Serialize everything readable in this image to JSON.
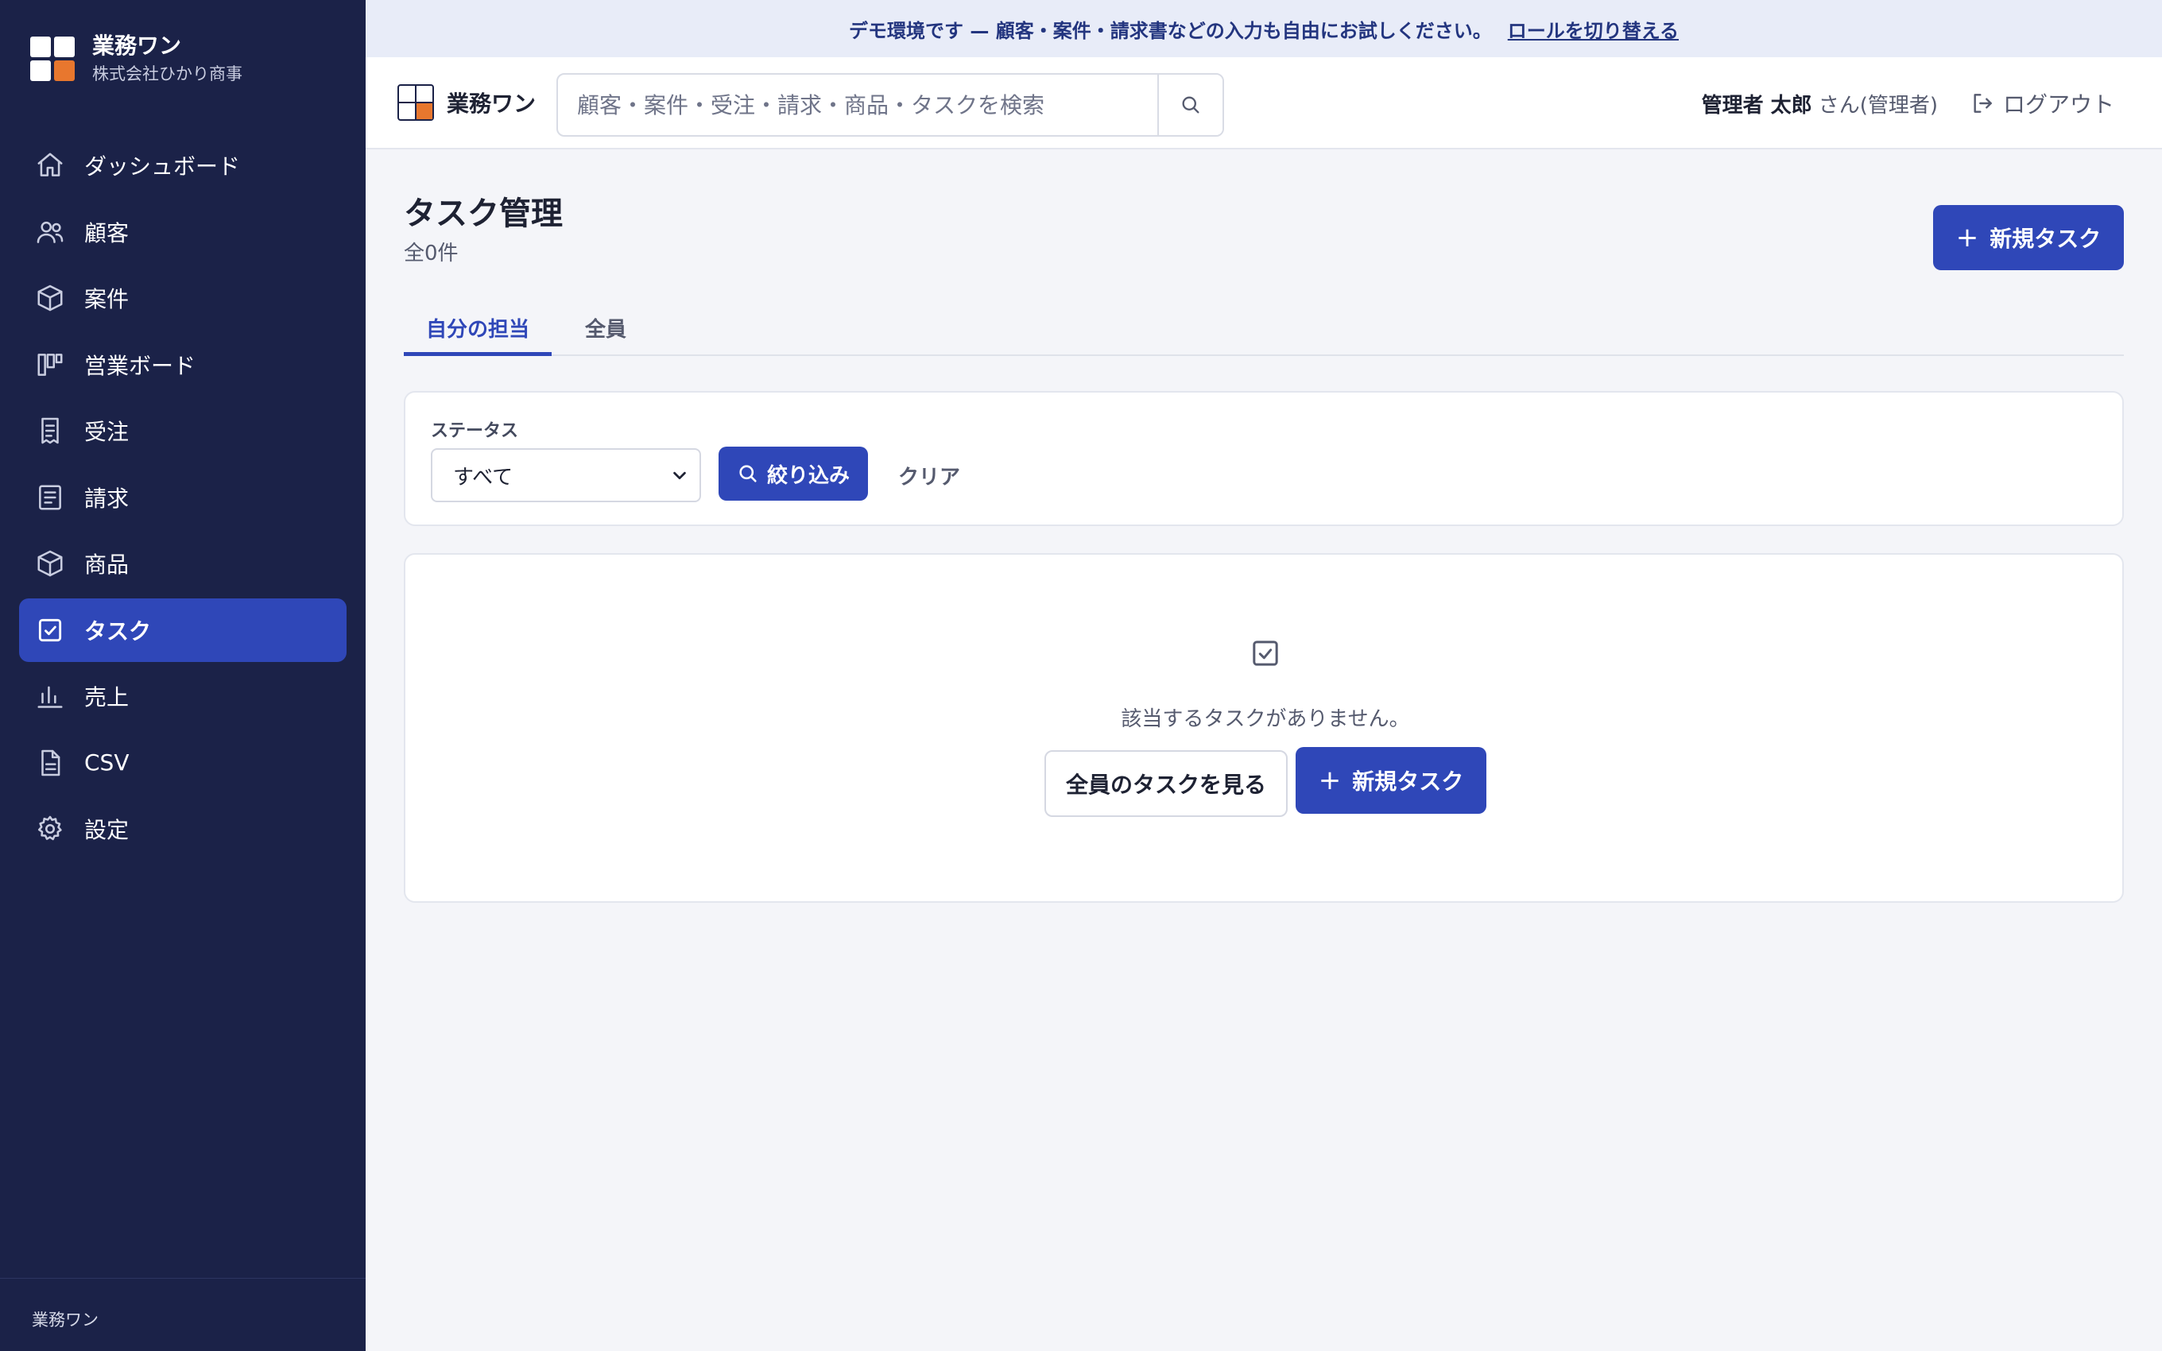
{
  "app": {
    "name": "業務ワン",
    "company": "株式会社ひかり商事",
    "logo_colors": [
      "#ffffff",
      "#ffffff",
      "#ffffff",
      "#e8772e"
    ]
  },
  "sidebar": {
    "items": [
      {
        "label": "ダッシュボード",
        "icon": "home-icon"
      },
      {
        "label": "顧客",
        "icon": "users-icon"
      },
      {
        "label": "案件",
        "icon": "box-icon"
      },
      {
        "label": "営業ボード",
        "icon": "kanban-icon"
      },
      {
        "label": "受注",
        "icon": "receipt-icon"
      },
      {
        "label": "請求",
        "icon": "document-icon"
      },
      {
        "label": "商品",
        "icon": "package-icon"
      },
      {
        "label": "タスク",
        "icon": "checkbox-icon",
        "active": true
      },
      {
        "label": "売上",
        "icon": "bar-chart-icon"
      },
      {
        "label": "CSV",
        "icon": "file-icon"
      },
      {
        "label": "設定",
        "icon": "gear-icon"
      }
    ],
    "footer": "業務ワン"
  },
  "banner": {
    "text": "デモ環境です — 顧客・案件・請求書などの入力も自由にお試しください。",
    "link": "ロールを切り替える"
  },
  "header": {
    "brand": "業務ワン",
    "search_placeholder": "顧客・案件・受注・請求・商品・タスクを検索",
    "user_name": "管理者 太郎",
    "user_suffix": "さん(管理者)",
    "logout": "ログアウト"
  },
  "page": {
    "title": "タスク管理",
    "count": "全0件",
    "new_task": "新規タスク",
    "tabs": [
      {
        "label": "自分の担当",
        "active": true
      },
      {
        "label": "全員",
        "active": false
      }
    ],
    "filter": {
      "status_label": "ステータス",
      "status_value": "すべて",
      "apply": "絞り込み",
      "clear": "クリア"
    },
    "empty": {
      "message": "該当するタスクがありません。",
      "view_all": "全員のタスクを見る",
      "new_task": "新規タスク"
    }
  },
  "colors": {
    "sidebar_bg": "#1b2248",
    "accent": "#2f47b8",
    "banner_bg": "#e8ecf8",
    "banner_text": "#23357f",
    "logo_accent": "#e8772e",
    "page_bg": "#f4f5f9"
  }
}
